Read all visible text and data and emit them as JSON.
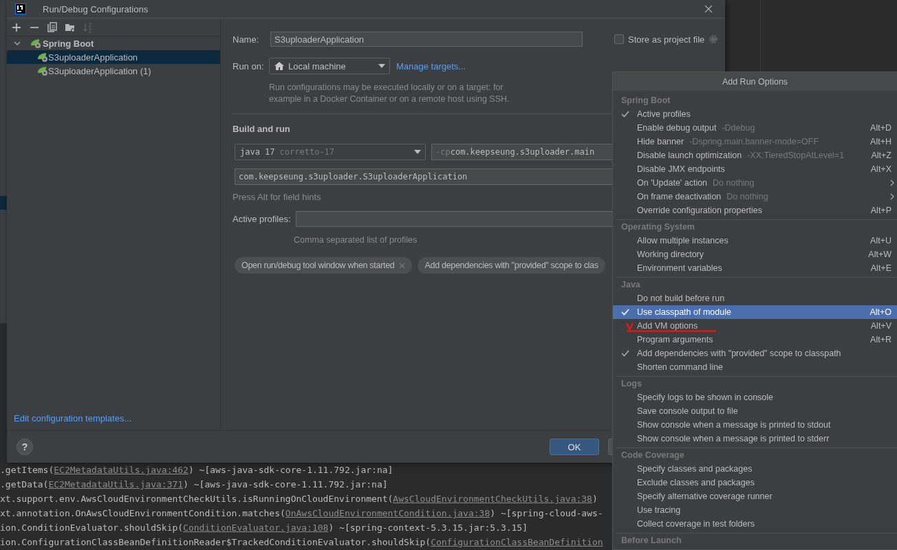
{
  "window": {
    "title": "Run/Debug Configurations"
  },
  "toolbar": [
    {
      "kind": "add",
      "disabled": false
    },
    {
      "kind": "remove",
      "disabled": false
    },
    {
      "kind": "copy",
      "disabled": false
    },
    {
      "kind": "folder",
      "disabled": false
    },
    {
      "kind": "sort",
      "disabled": true
    }
  ],
  "tree": [
    {
      "label": "Spring Boot",
      "expanded": true,
      "selected": false,
      "children": [
        {
          "label": "S3uploaderApplication",
          "selected": true
        },
        {
          "label": "S3uploaderApplication (1)",
          "selected": false
        }
      ]
    }
  ],
  "templates_link": "Edit configuration templates...",
  "form": {
    "name_label": "Name:",
    "name_value": "S3uploaderApplication",
    "store_label": "Store as project file",
    "store_checked": false,
    "run_on_label": "Run on:",
    "run_on_value": "Local machine",
    "manage_link": "Manage targets...",
    "run_on_note": "Run configurations may be executed locally or on a target: for\nexample in a Docker Container or on a remote host using SSH.",
    "section": "Build and run",
    "jdk": "java 17",
    "jdk_hint": "corretto-17",
    "cp_prefix": "-cp",
    "cp_value": "com.keepseung.s3uploader.main",
    "main_class": "com.keepseung.s3uploader.S3uploaderApplication",
    "alt_hint": "Press Alt for field hints",
    "profiles_label": "Active profiles:",
    "profiles_note": "Comma separated list of profiles",
    "chips": [
      {
        "label": "Open run/debug tool window when started",
        "removable": true
      },
      {
        "label": "Add dependencies with \"provided\" scope to clas",
        "removable": false
      }
    ]
  },
  "footer": {
    "help": "?",
    "ok": "OK"
  },
  "menu": {
    "title": "Add Run Options",
    "sections": [
      {
        "title": "Spring Boot",
        "items": [
          {
            "label": "Active profiles",
            "checked": true,
            "selected": false,
            "submenu": false,
            "annotated": false
          },
          {
            "label": "Enable debug output",
            "hint": "-Ddebug",
            "shortcut": "Alt+D",
            "checked": false,
            "selected": false,
            "submenu": false,
            "annotated": false
          },
          {
            "label": "Hide banner",
            "hint": "-Dspring.main.banner-mode=OFF",
            "shortcut": "Alt+H",
            "checked": false,
            "selected": false,
            "submenu": false,
            "annotated": false
          },
          {
            "label": "Disable launch optimization",
            "hint": "-XX:TieredStopAtLevel=1",
            "shortcut": "Alt+Z",
            "checked": false,
            "selected": false,
            "submenu": false,
            "annotated": false
          },
          {
            "label": "Disable JMX endpoints",
            "shortcut": "Alt+X",
            "checked": false,
            "selected": false,
            "submenu": false,
            "annotated": false
          },
          {
            "label": "On 'Update' action",
            "hint": "Do nothing",
            "checked": false,
            "selected": false,
            "submenu": true,
            "annotated": false
          },
          {
            "label": "On frame deactivation",
            "hint": "Do nothing",
            "checked": false,
            "selected": false,
            "submenu": true,
            "annotated": false
          },
          {
            "label": "Override configuration properties",
            "shortcut": "Alt+P",
            "checked": false,
            "selected": false,
            "submenu": false,
            "annotated": false
          }
        ]
      },
      {
        "title": "Operating System",
        "items": [
          {
            "label": "Allow multiple instances",
            "shortcut": "Alt+U",
            "checked": false,
            "selected": false,
            "submenu": false,
            "annotated": false
          },
          {
            "label": "Working directory",
            "shortcut": "Alt+W",
            "checked": false,
            "selected": false,
            "submenu": false,
            "annotated": false
          },
          {
            "label": "Environment variables",
            "shortcut": "Alt+E",
            "checked": false,
            "selected": false,
            "submenu": false,
            "annotated": false
          }
        ]
      },
      {
        "title": "Java",
        "items": [
          {
            "label": "Do not build before run",
            "checked": false,
            "selected": false,
            "submenu": false,
            "annotated": false
          },
          {
            "label": "Use classpath of module",
            "shortcut": "Alt+O",
            "checked": true,
            "selected": true,
            "submenu": false,
            "annotated": false
          },
          {
            "label": "Add VM options",
            "shortcut": "Alt+V",
            "checked": false,
            "selected": false,
            "submenu": false,
            "annotated": true
          },
          {
            "label": "Program arguments",
            "shortcut": "Alt+R",
            "checked": false,
            "selected": false,
            "submenu": false,
            "annotated": false
          },
          {
            "label": "Add dependencies with \"provided\" scope to classpath",
            "checked": true,
            "selected": false,
            "submenu": false,
            "annotated": false
          },
          {
            "label": "Shorten command line",
            "checked": false,
            "selected": false,
            "submenu": false,
            "annotated": false
          }
        ]
      },
      {
        "title": "Logs",
        "items": [
          {
            "label": "Specify logs to be shown in console",
            "checked": false,
            "selected": false,
            "submenu": false,
            "annotated": false
          },
          {
            "label": "Save console output to file",
            "checked": false,
            "selected": false,
            "submenu": false,
            "annotated": false
          },
          {
            "label": "Show console when a message is printed to stdout",
            "checked": false,
            "selected": false,
            "submenu": false,
            "annotated": false
          },
          {
            "label": "Show console when a message is printed to stderr",
            "checked": false,
            "selected": false,
            "submenu": false,
            "annotated": false
          }
        ]
      },
      {
        "title": "Code Coverage",
        "items": [
          {
            "label": "Specify classes and packages",
            "checked": false,
            "selected": false,
            "submenu": false,
            "annotated": false
          },
          {
            "label": "Exclude classes and packages",
            "checked": false,
            "selected": false,
            "submenu": false,
            "annotated": false
          },
          {
            "label": "Specify alternative coverage runner",
            "checked": false,
            "selected": false,
            "submenu": false,
            "annotated": false
          },
          {
            "label": "Use tracing",
            "checked": false,
            "selected": false,
            "submenu": false,
            "annotated": false
          },
          {
            "label": "Collect coverage in test folders",
            "checked": false,
            "selected": false,
            "submenu": false,
            "annotated": false
          }
        ]
      },
      {
        "title": "Before Launch"
      }
    ]
  },
  "console": [
    {
      "before": ".getItems(",
      "link": "EC2MetadataUtils.java:462",
      "after": ") ~[aws-java-sdk-core-1.11.792.jar:na]"
    },
    {
      "before": ".getData(",
      "link": "EC2MetadataUtils.java:371",
      "after": ") ~[aws-java-sdk-core-1.11.792.jar:na]"
    },
    {
      "before": "xt.support.env.AwsCloudEnvironmentCheckUtils.isRunningOnCloudEnvironment(",
      "link": "AwsCloudEnvironmentCheckUtils.java:38",
      "after": ")"
    },
    {
      "before": "xt.annotation.OnAwsCloudEnvironmentCondition.matches(",
      "link": "OnAwsCloudEnvironmentCondition.java:38",
      "after": ") ~[spring-cloud-aws-"
    },
    {
      "before": "ion.ConditionEvaluator.shouldSkip(",
      "link": "ConditionEvaluator.java:108",
      "after": ") ~[spring-context-5.3.15.jar:5.3.15]"
    },
    {
      "before": "ion.ConfigurationClassBeanDefinitionReader$TrackedConditionEvaluator.shouldSkip(",
      "link": "ConfigurationClassBeanDefinition"
    }
  ]
}
